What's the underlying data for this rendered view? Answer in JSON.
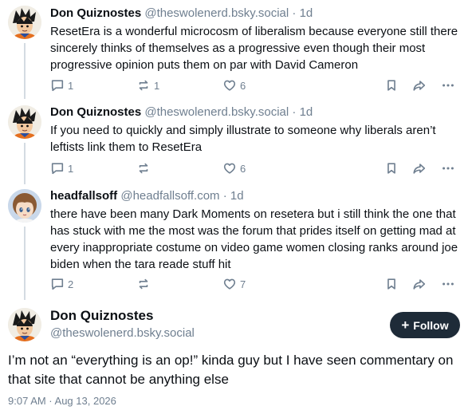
{
  "thread": [
    {
      "author": "Don Quiznostes",
      "handle": "@theswolenerd.bsky.social",
      "sep": "·",
      "time": "1d",
      "avatar": "goku-avatar",
      "text": "ResetEra is a wonderful microcosm of liberalism because everyone still there sincerely thinks of themselves as a progressive even though their most progressive opinion puts them on par with David Cameron",
      "replies": "1",
      "reposts": "1",
      "likes": "6"
    },
    {
      "author": "Don Quiznostes",
      "handle": "@theswolenerd.bsky.social",
      "sep": "·",
      "time": "1d",
      "avatar": "goku-avatar",
      "text": "If you need to quickly and simply illustrate to someone why liberals aren’t leftists link them to ResetEra",
      "replies": "1",
      "reposts": "",
      "likes": "6"
    },
    {
      "author": "headfallsoff",
      "handle": "@headfallsoff.com",
      "sep": "·",
      "time": "1d",
      "avatar": "anime-girl-avatar",
      "text": "there have been many Dark Moments on resetera but i still think the one that has stuck with me the most was the forum that prides itself on getting mad at every inappropriate costume on video game women closing ranks around joe biden when the tara reade stuff hit",
      "replies": "2",
      "reposts": "",
      "likes": "7"
    }
  ],
  "main_post": {
    "author": "Don Quiznostes",
    "handle": "@theswolenerd.bsky.social",
    "follow_label": "Follow",
    "text": "I’m not an “everything is an op!” kinda guy but I have seen commentary on that site that cannot be anything else",
    "timestamp": "9:07 AM · Aug 13, 2026"
  },
  "icons": {
    "reply": "speech-bubble-icon",
    "repost": "repost-arrows-icon",
    "like": "heart-icon",
    "bookmark": "bookmark-icon",
    "share": "share-arrow-icon",
    "more": "more-dots-icon"
  },
  "colors": {
    "text": "#0b0f14",
    "muted": "#6f7f90",
    "follow_bg": "#1e2b38",
    "thread_line": "#d4dbe2"
  }
}
